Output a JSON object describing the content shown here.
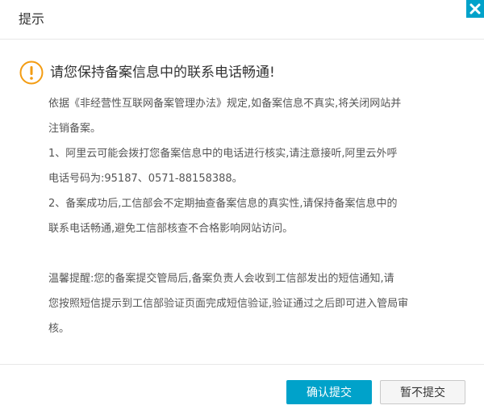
{
  "dialog": {
    "title": "提示",
    "close_icon": "close-icon"
  },
  "notice": {
    "icon": "warning-icon",
    "accent_color": "#f39c12",
    "heading": "请您保持备案信息中的联系电话畅通!",
    "lines": [
      "依据《非经营性互联网备案管理办法》规定,如备案信息不真实,将关闭网站并",
      "注销备案。",
      "1、阿里云可能会拨打您备案信息中的电话进行核实,请注意接听,阿里云外呼",
      "电话号码为:95187、0571-88158388。",
      "2、备案成功后,工信部会不定期抽查备案信息的真实性,请保持备案信息中的",
      "联系电话畅通,避免工信部核查不合格影响网站访问。",
      "温馨提醒:您的备案提交管局后,备案负责人会收到工信部发出的短信通知,请",
      "您按照短信提示到工信部验证页面完成短信验证,验证通过之后即可进入管局审",
      "核。"
    ]
  },
  "footer": {
    "confirm_label": "确认提交",
    "cancel_label": "暂不提交",
    "primary_color": "#00a2ca"
  }
}
